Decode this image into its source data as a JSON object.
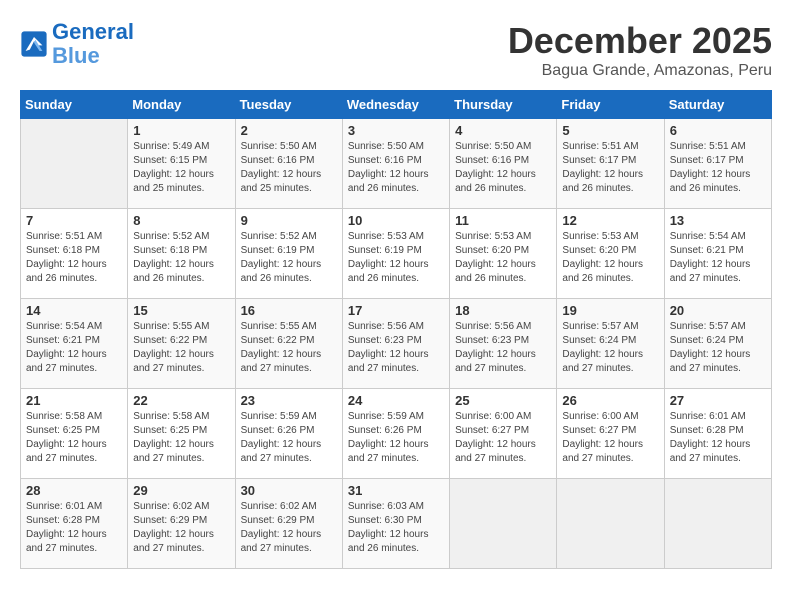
{
  "logo": {
    "line1": "General",
    "line2": "Blue"
  },
  "title": "December 2025",
  "location": "Bagua Grande, Amazonas, Peru",
  "days_of_week": [
    "Sunday",
    "Monday",
    "Tuesday",
    "Wednesday",
    "Thursday",
    "Friday",
    "Saturday"
  ],
  "weeks": [
    [
      {
        "day": "",
        "sunrise": "",
        "sunset": "",
        "daylight": ""
      },
      {
        "day": "1",
        "sunrise": "Sunrise: 5:49 AM",
        "sunset": "Sunset: 6:15 PM",
        "daylight": "Daylight: 12 hours and 25 minutes."
      },
      {
        "day": "2",
        "sunrise": "Sunrise: 5:50 AM",
        "sunset": "Sunset: 6:16 PM",
        "daylight": "Daylight: 12 hours and 25 minutes."
      },
      {
        "day": "3",
        "sunrise": "Sunrise: 5:50 AM",
        "sunset": "Sunset: 6:16 PM",
        "daylight": "Daylight: 12 hours and 26 minutes."
      },
      {
        "day": "4",
        "sunrise": "Sunrise: 5:50 AM",
        "sunset": "Sunset: 6:16 PM",
        "daylight": "Daylight: 12 hours and 26 minutes."
      },
      {
        "day": "5",
        "sunrise": "Sunrise: 5:51 AM",
        "sunset": "Sunset: 6:17 PM",
        "daylight": "Daylight: 12 hours and 26 minutes."
      },
      {
        "day": "6",
        "sunrise": "Sunrise: 5:51 AM",
        "sunset": "Sunset: 6:17 PM",
        "daylight": "Daylight: 12 hours and 26 minutes."
      }
    ],
    [
      {
        "day": "7",
        "sunrise": "Sunrise: 5:51 AM",
        "sunset": "Sunset: 6:18 PM",
        "daylight": "Daylight: 12 hours and 26 minutes."
      },
      {
        "day": "8",
        "sunrise": "Sunrise: 5:52 AM",
        "sunset": "Sunset: 6:18 PM",
        "daylight": "Daylight: 12 hours and 26 minutes."
      },
      {
        "day": "9",
        "sunrise": "Sunrise: 5:52 AM",
        "sunset": "Sunset: 6:19 PM",
        "daylight": "Daylight: 12 hours and 26 minutes."
      },
      {
        "day": "10",
        "sunrise": "Sunrise: 5:53 AM",
        "sunset": "Sunset: 6:19 PM",
        "daylight": "Daylight: 12 hours and 26 minutes."
      },
      {
        "day": "11",
        "sunrise": "Sunrise: 5:53 AM",
        "sunset": "Sunset: 6:20 PM",
        "daylight": "Daylight: 12 hours and 26 minutes."
      },
      {
        "day": "12",
        "sunrise": "Sunrise: 5:53 AM",
        "sunset": "Sunset: 6:20 PM",
        "daylight": "Daylight: 12 hours and 26 minutes."
      },
      {
        "day": "13",
        "sunrise": "Sunrise: 5:54 AM",
        "sunset": "Sunset: 6:21 PM",
        "daylight": "Daylight: 12 hours and 27 minutes."
      }
    ],
    [
      {
        "day": "14",
        "sunrise": "Sunrise: 5:54 AM",
        "sunset": "Sunset: 6:21 PM",
        "daylight": "Daylight: 12 hours and 27 minutes."
      },
      {
        "day": "15",
        "sunrise": "Sunrise: 5:55 AM",
        "sunset": "Sunset: 6:22 PM",
        "daylight": "Daylight: 12 hours and 27 minutes."
      },
      {
        "day": "16",
        "sunrise": "Sunrise: 5:55 AM",
        "sunset": "Sunset: 6:22 PM",
        "daylight": "Daylight: 12 hours and 27 minutes."
      },
      {
        "day": "17",
        "sunrise": "Sunrise: 5:56 AM",
        "sunset": "Sunset: 6:23 PM",
        "daylight": "Daylight: 12 hours and 27 minutes."
      },
      {
        "day": "18",
        "sunrise": "Sunrise: 5:56 AM",
        "sunset": "Sunset: 6:23 PM",
        "daylight": "Daylight: 12 hours and 27 minutes."
      },
      {
        "day": "19",
        "sunrise": "Sunrise: 5:57 AM",
        "sunset": "Sunset: 6:24 PM",
        "daylight": "Daylight: 12 hours and 27 minutes."
      },
      {
        "day": "20",
        "sunrise": "Sunrise: 5:57 AM",
        "sunset": "Sunset: 6:24 PM",
        "daylight": "Daylight: 12 hours and 27 minutes."
      }
    ],
    [
      {
        "day": "21",
        "sunrise": "Sunrise: 5:58 AM",
        "sunset": "Sunset: 6:25 PM",
        "daylight": "Daylight: 12 hours and 27 minutes."
      },
      {
        "day": "22",
        "sunrise": "Sunrise: 5:58 AM",
        "sunset": "Sunset: 6:25 PM",
        "daylight": "Daylight: 12 hours and 27 minutes."
      },
      {
        "day": "23",
        "sunrise": "Sunrise: 5:59 AM",
        "sunset": "Sunset: 6:26 PM",
        "daylight": "Daylight: 12 hours and 27 minutes."
      },
      {
        "day": "24",
        "sunrise": "Sunrise: 5:59 AM",
        "sunset": "Sunset: 6:26 PM",
        "daylight": "Daylight: 12 hours and 27 minutes."
      },
      {
        "day": "25",
        "sunrise": "Sunrise: 6:00 AM",
        "sunset": "Sunset: 6:27 PM",
        "daylight": "Daylight: 12 hours and 27 minutes."
      },
      {
        "day": "26",
        "sunrise": "Sunrise: 6:00 AM",
        "sunset": "Sunset: 6:27 PM",
        "daylight": "Daylight: 12 hours and 27 minutes."
      },
      {
        "day": "27",
        "sunrise": "Sunrise: 6:01 AM",
        "sunset": "Sunset: 6:28 PM",
        "daylight": "Daylight: 12 hours and 27 minutes."
      }
    ],
    [
      {
        "day": "28",
        "sunrise": "Sunrise: 6:01 AM",
        "sunset": "Sunset: 6:28 PM",
        "daylight": "Daylight: 12 hours and 27 minutes."
      },
      {
        "day": "29",
        "sunrise": "Sunrise: 6:02 AM",
        "sunset": "Sunset: 6:29 PM",
        "daylight": "Daylight: 12 hours and 27 minutes."
      },
      {
        "day": "30",
        "sunrise": "Sunrise: 6:02 AM",
        "sunset": "Sunset: 6:29 PM",
        "daylight": "Daylight: 12 hours and 27 minutes."
      },
      {
        "day": "31",
        "sunrise": "Sunrise: 6:03 AM",
        "sunset": "Sunset: 6:30 PM",
        "daylight": "Daylight: 12 hours and 26 minutes."
      },
      {
        "day": "",
        "sunrise": "",
        "sunset": "",
        "daylight": ""
      },
      {
        "day": "",
        "sunrise": "",
        "sunset": "",
        "daylight": ""
      },
      {
        "day": "",
        "sunrise": "",
        "sunset": "",
        "daylight": ""
      }
    ]
  ]
}
